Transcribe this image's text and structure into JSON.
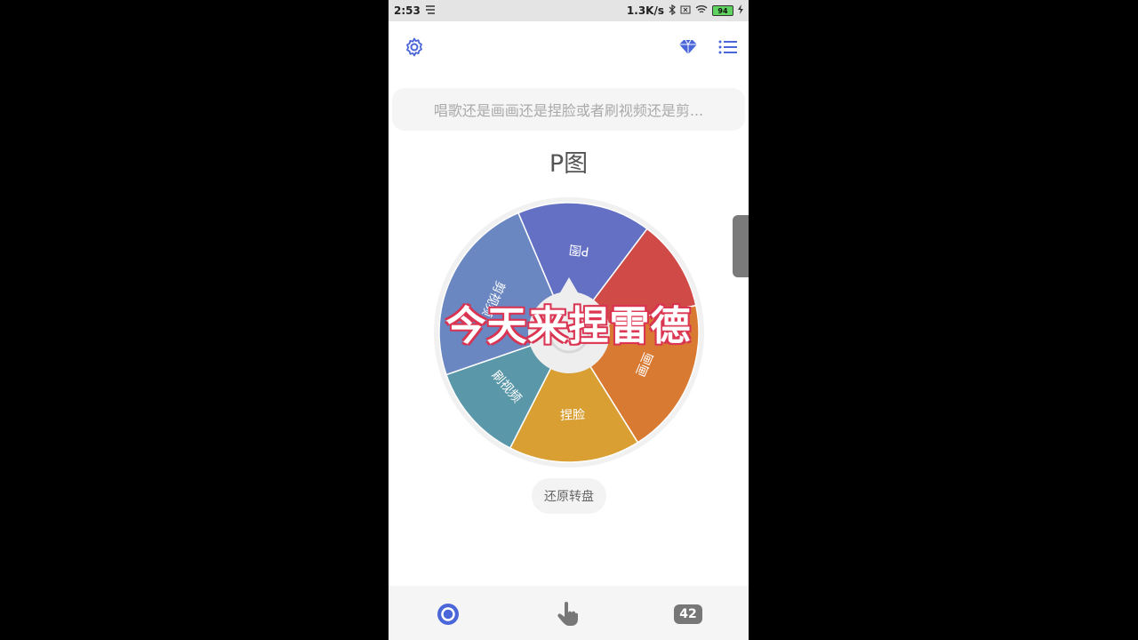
{
  "status_bar": {
    "time": "2:53",
    "net_speed": "1.3K/s",
    "battery": "94"
  },
  "search": {
    "text": "唱歌还是画画还是捏脸或者刷视频还是剪..."
  },
  "result": {
    "label": "P图"
  },
  "wheel": {
    "segments": [
      {
        "label": "P图",
        "color": "#6470c4"
      },
      {
        "label": "",
        "color": "#d04a48"
      },
      {
        "label": "画画",
        "color": "#d97a33"
      },
      {
        "label": "捏脸",
        "color": "#d99f33"
      },
      {
        "label": "刷视频",
        "color": "#5a97a8"
      },
      {
        "label": "剪视频",
        "color": "#6a87c2"
      }
    ]
  },
  "overlay": {
    "text": "今天来捏雷德"
  },
  "reset_button": {
    "label": "还原转盘"
  },
  "bottom_nav": {
    "count": "42"
  },
  "colors": {
    "accent": "#4a66d8"
  }
}
